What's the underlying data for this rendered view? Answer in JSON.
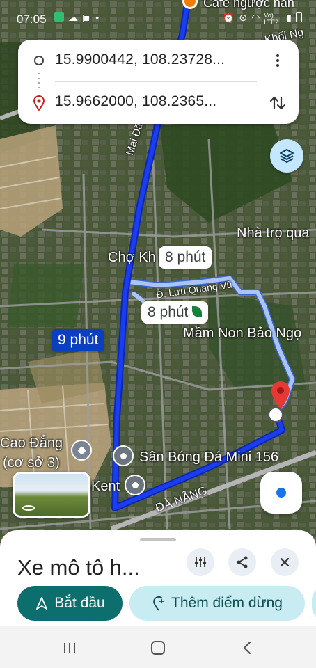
{
  "status_bar": {
    "time": "07:05",
    "left_icons": [
      "check-icon",
      "cloud-icon",
      "image-icon",
      "dot-icon"
    ],
    "right_icons": [
      "alarm-icon",
      "location-icon",
      "wifi-icon",
      "signal-icon",
      "battery-icon"
    ],
    "network": "Vo) LTE2"
  },
  "route": {
    "origin": "15.9900442, 108.23728...",
    "destination": "15.9662000, 108.2365..."
  },
  "time_labels": {
    "primary": "9 phút",
    "alt1": "8 phút",
    "alt2": "8 phút"
  },
  "map_labels": {
    "top_place": "Cafe ngược nắn",
    "khoi": "Khối Ng",
    "mai_dang_chinh": "Mai Đăng C",
    "nha_tro": "Nhà trọ qua",
    "cho": "Chợ Kh",
    "luu_quang_vu": "Đ. Lưu Quang Vũ",
    "mam_non": "Mầm Non Bảo Ngọ",
    "cao_dang": "Cao Đẳng",
    "co_so": "(cơ sở 3)",
    "san_bong": "Sân Bóng Đá Mini 156",
    "kent": "Kent",
    "da_nang": "ĐÀ NẴNG"
  },
  "sheet": {
    "title": "Xe mô tô h...",
    "start_label": "Bắt đầu",
    "add_stop_label": "Thêm điểm dừng"
  },
  "colors": {
    "route_primary": "#1a3df0",
    "route_alt": "#a9c4f5",
    "start_button": "#0d6e6e",
    "stop_button": "#c9ecf2",
    "destination_pin": "#e53935"
  }
}
